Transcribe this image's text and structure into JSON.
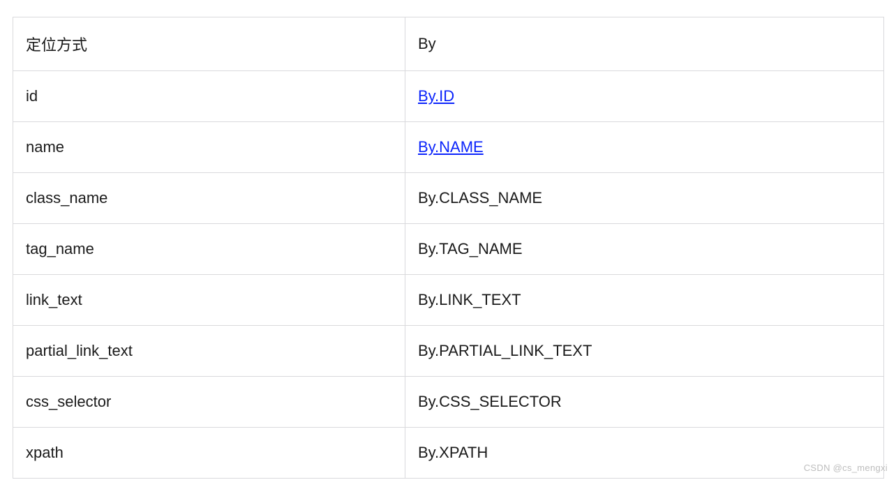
{
  "table": {
    "header": {
      "method": "定位方式",
      "by": "By"
    },
    "rows": [
      {
        "method": "id",
        "by": "By.ID",
        "link": true
      },
      {
        "method": "name",
        "by": "By.NAME",
        "link": true
      },
      {
        "method": "class_name",
        "by": "By.CLASS_NAME",
        "link": false
      },
      {
        "method": "tag_name",
        "by": "By.TAG_NAME",
        "link": false
      },
      {
        "method": "link_text",
        "by": "By.LINK_TEXT",
        "link": false
      },
      {
        "method": "partial_link_text",
        "by": "By.PARTIAL_LINK_TEXT",
        "link": false
      },
      {
        "method": "css_selector",
        "by": "By.CSS_SELECTOR",
        "link": false
      },
      {
        "method": "xpath",
        "by": "By.XPATH",
        "link": false
      }
    ]
  },
  "watermark": "CSDN @cs_mengxi"
}
